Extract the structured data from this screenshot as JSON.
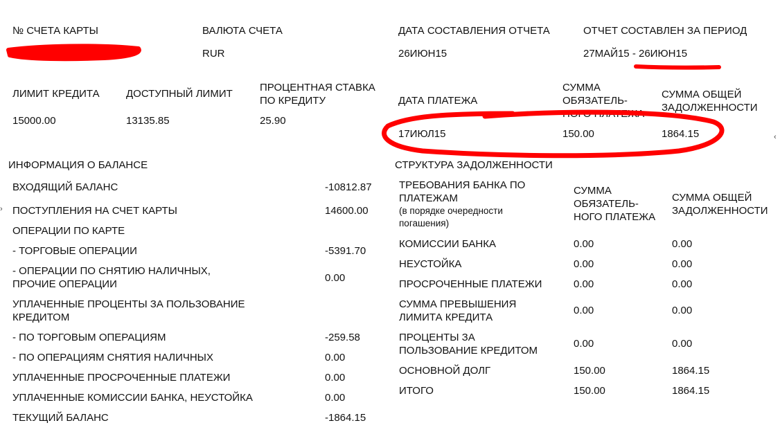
{
  "header": {
    "card_account_label": "№ СЧЕТА КАРТЫ",
    "currency_label": "ВАЛЮТА СЧЕТА",
    "currency_value": "RUR",
    "report_date_label": "ДАТА СОСТАВЛЕНИЯ ОТЧЕТА",
    "report_date_value": "26ИЮН15",
    "period_label": "ОТЧЕТ СОСТАВЛЕН ЗА ПЕРИОД",
    "period_value": "27МАЙ15 - 26ИЮН15"
  },
  "credit": {
    "limit_label": "ЛИМИТ КРЕДИТА",
    "limit_value": "15000.00",
    "available_label": "ДОСТУПНЫЙ ЛИМИТ",
    "available_value": "13135.85",
    "rate_label_1": "ПРОЦЕНТНАЯ СТАВКА",
    "rate_label_2": "ПО КРЕДИТУ",
    "rate_value": "25.90"
  },
  "payment": {
    "date_label": "ДАТА ПЛАТЕЖА",
    "date_value": "17ИЮЛ15",
    "mandatory_label_1": "СУММА",
    "mandatory_label_2": "ОБЯЗАТЕЛЬ-",
    "mandatory_label_3": "НОГО ПЛАТЕЖА",
    "mandatory_value": "150.00",
    "total_label_1": "СУММА ОБЩЕЙ",
    "total_label_2": "ЗАДОЛЖЕННОСТИ",
    "total_value": "1864.15"
  },
  "balance": {
    "title": "ИНФОРМАЦИЯ О БАЛАНСЕ",
    "rows": [
      {
        "label": "ВХОДЯЩИЙ БАЛАНС",
        "value": "-10812.87"
      },
      {
        "label": "ПОСТУПЛЕНИЯ НА СЧЕТ КАРТЫ",
        "value": "14600.00"
      },
      {
        "label": "ОПЕРАЦИИ ПО КАРТЕ",
        "value": ""
      },
      {
        "label": "- ТОРГОВЫЕ ОПЕРАЦИИ",
        "value": "-5391.70"
      },
      {
        "label": "- ОПЕРАЦИИ ПО СНЯТИЮ НАЛИЧНЫХ,",
        "label2": "ПРОЧИЕ ОПЕРАЦИИ",
        "value": "0.00"
      },
      {
        "label": "УПЛАЧЕННЫЕ ПРОЦЕНТЫ ЗА ПОЛЬЗОВАНИЕ",
        "label2": "КРЕДИТОМ",
        "value": ""
      },
      {
        "label": "- ПО ТОРГОВЫМ ОПЕРАЦИЯМ",
        "value": "-259.58"
      },
      {
        "label": "- ПО ОПЕРАЦИЯМ СНЯТИЯ НАЛИЧНЫХ",
        "value": "0.00"
      },
      {
        "label": "УПЛАЧЕННЫЕ ПРОСРОЧЕННЫЕ ПЛАТЕЖИ",
        "value": "0.00"
      },
      {
        "label": "УПЛАЧЕННЫЕ КОМИССИИ БАНКА, НЕУСТОЙКА",
        "value": "0.00"
      },
      {
        "label": "ТЕКУЩИЙ БАЛАНС",
        "value": "-1864.15"
      }
    ]
  },
  "debt": {
    "title": "СТРУКТУРА ЗАДОЛЖЕННОСТИ",
    "col1_label_1": "ТРЕБОВАНИЯ БАНКА ПО",
    "col1_label_2": "ПЛАТЕЖАМ",
    "col1_note_1": "(в порядке очередности",
    "col1_note_2": "погашения)",
    "col2_label_1": "СУММА",
    "col2_label_2": "ОБЯЗАТЕЛЬ-",
    "col2_label_3": "НОГО ПЛАТЕЖА",
    "col3_label_1": "СУММА ОБЩЕЙ",
    "col3_label_2": "ЗАДОЛЖЕННОСТИ",
    "rows": [
      {
        "label": "КОМИССИИ БАНКА",
        "mandatory": "0.00",
        "total": "0.00"
      },
      {
        "label": "НЕУСТОЙКА",
        "mandatory": "0.00",
        "total": "0.00"
      },
      {
        "label": "ПРОСРОЧЕННЫЕ ПЛАТЕЖИ",
        "mandatory": "0.00",
        "total": "0.00"
      },
      {
        "label": "СУММА ПРЕВЫШЕНИЯ",
        "label2": "ЛИМИТА КРЕДИТА",
        "mandatory": "0.00",
        "total": "0.00"
      },
      {
        "label": "ПРОЦЕНТЫ ЗА",
        "label2": "ПОЛЬЗОВАНИЕ КРЕДИТОМ",
        "mandatory": "0.00",
        "total": "0.00"
      },
      {
        "label": "ОСНОВНОЙ ДОЛГ",
        "mandatory": "150.00",
        "total": "1864.15"
      },
      {
        "label": "ИТОГО",
        "mandatory": "150.00",
        "total": "1864.15"
      }
    ]
  },
  "annotation_color": "#ff0000"
}
